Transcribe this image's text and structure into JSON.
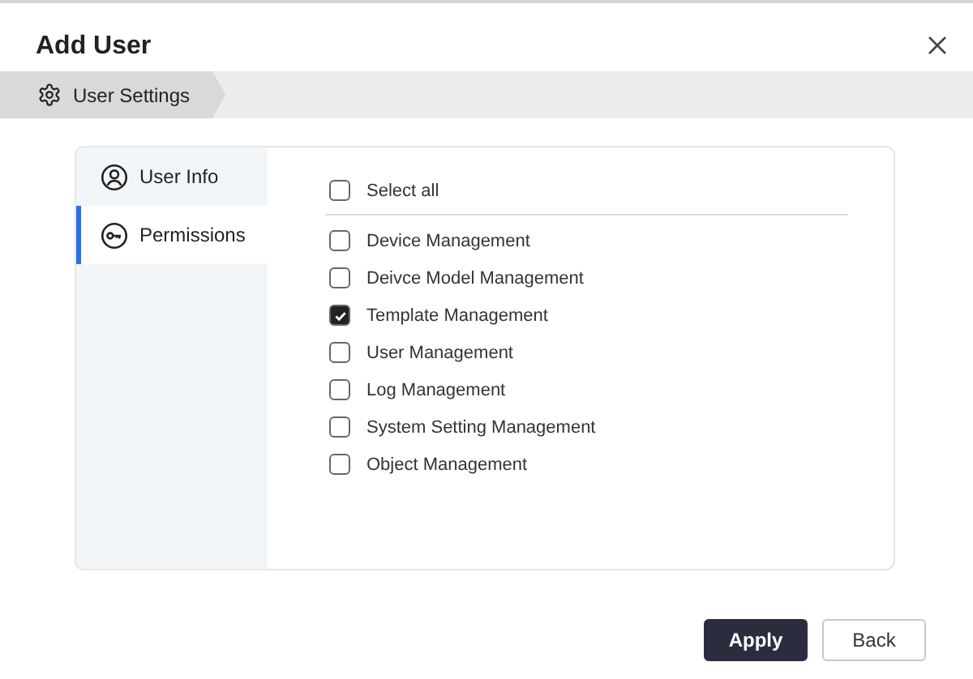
{
  "window": {
    "title": "Add User"
  },
  "breadcrumb": {
    "label": "User Settings"
  },
  "nav": [
    {
      "label": "User Info",
      "kind": "user",
      "selected": false
    },
    {
      "label": "Permissions",
      "kind": "key",
      "selected": true
    }
  ],
  "select_all": {
    "label": "Select all",
    "checked": false
  },
  "permissions": [
    {
      "label": "Device Management",
      "checked": false
    },
    {
      "label": "Deivce Model Management",
      "checked": false
    },
    {
      "label": "Template Management",
      "checked": true
    },
    {
      "label": "User Management",
      "checked": false
    },
    {
      "label": "Log Management",
      "checked": false
    },
    {
      "label": "System Setting Management",
      "checked": false
    },
    {
      "label": "Object Management",
      "checked": false
    }
  ],
  "buttons": [
    {
      "label": "Apply",
      "kind": "primary"
    },
    {
      "label": "Back",
      "kind": "secondary"
    }
  ]
}
